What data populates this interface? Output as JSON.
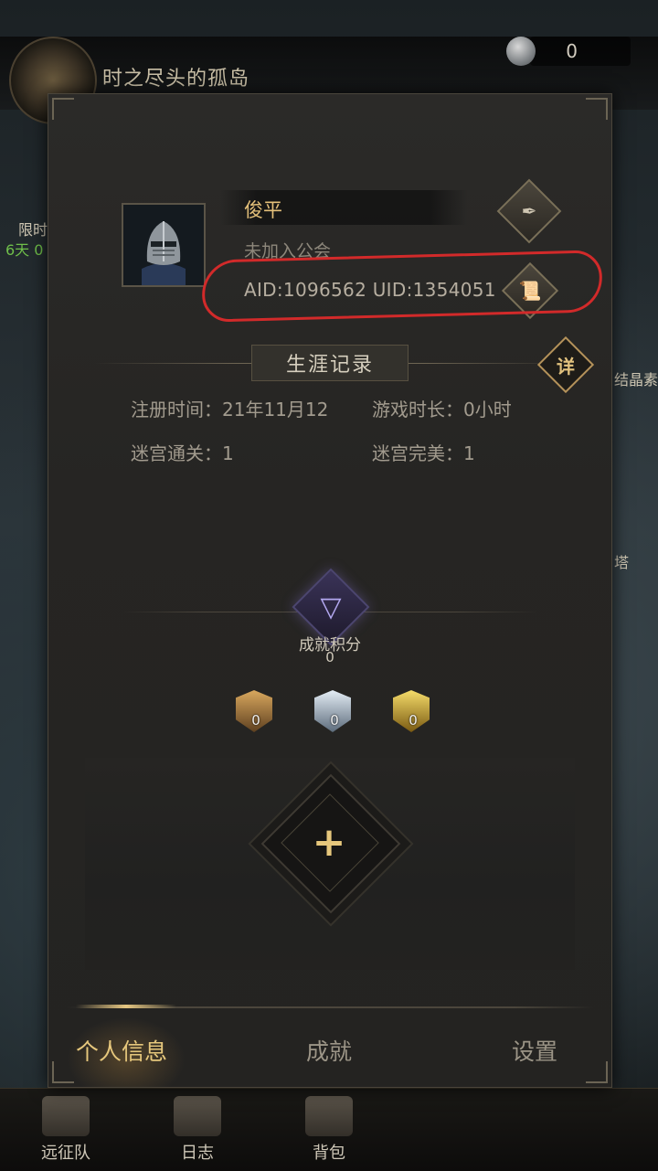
{
  "background": {
    "map_title": "时之尽头的孤岛",
    "currency_value": "0",
    "left_event_label": "限时",
    "left_event_timer": "6天 0",
    "right_label_1": "结晶素",
    "right_label_2": "塔"
  },
  "profile": {
    "player_name": "俊平",
    "guild_status": "未加入公会",
    "ids_text": "AID:1096562  UID:1354051",
    "edit_icon": "quill-icon",
    "copy_icon": "scroll-copy-icon"
  },
  "career": {
    "title": "生涯记录",
    "detail_label": "详",
    "stats": [
      {
        "label": "注册时间：21年11月12"
      },
      {
        "label": "游戏时长：0小时"
      },
      {
        "label": "迷宫通关：1"
      },
      {
        "label": "迷宫完美：1"
      }
    ]
  },
  "achievement": {
    "label": "成就积分",
    "score": "0",
    "badges": [
      {
        "count": "0",
        "color": "#b58a4a"
      },
      {
        "count": "0",
        "color": "#9fb3c8"
      },
      {
        "count": "0",
        "color": "#d8b24a"
      }
    ],
    "add_label": "+"
  },
  "tabs": [
    {
      "label": "个人信息",
      "active": true
    },
    {
      "label": "成就",
      "active": false
    },
    {
      "label": "设置",
      "active": false
    }
  ],
  "bottom_nav": [
    {
      "label": "远征队"
    },
    {
      "label": "日志"
    },
    {
      "label": "背包"
    }
  ],
  "colors": {
    "accent_gold": "#e6c77c",
    "annotation_red": "#d22a2a"
  }
}
